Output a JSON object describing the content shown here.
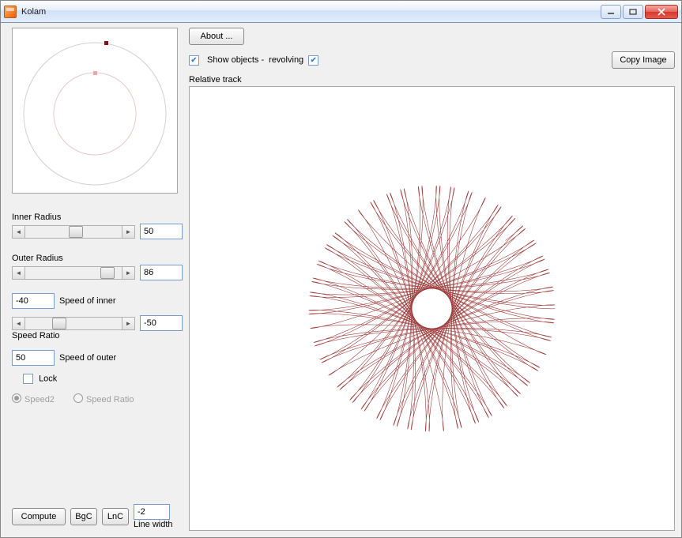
{
  "window": {
    "title": "Kolam"
  },
  "controls": {
    "inner_radius_label": "Inner Radius",
    "inner_radius_value": "50",
    "outer_radius_label": "Outer Radius",
    "outer_radius_value": "86",
    "speed_inner_value": "-40",
    "speed_inner_label": "Speed of inner",
    "speed_ratio_value": "-50",
    "speed_ratio_label": "Speed Ratio",
    "speed_outer_value": "50",
    "speed_outer_label": "Speed of outer",
    "lock_label": "Lock",
    "lock_checked": false,
    "radio_speed2_label": "Speed2",
    "radio_speedratio_label": "Speed Ratio",
    "compute_label": "Compute",
    "bgc_label": "BgC",
    "lnc_label": "LnC",
    "line_width_value": "-2",
    "line_width_label": "Line width"
  },
  "top": {
    "about_label": "About ...",
    "show_objects_label": "Show objects -",
    "revolving_label": "revolving",
    "show_objects_checked": true,
    "revolving_checked": true,
    "copy_image_label": "Copy Image",
    "canvas_label": "Relative track"
  },
  "chart_data": {
    "type": "spirograph",
    "inner_radius": 50,
    "outer_radius": 86,
    "speed_inner": -40,
    "speed_ratio": -50,
    "speed_outer": 50,
    "line_color": "#8b1a1a",
    "bg_color": "#ffffff",
    "line_width": -2
  }
}
